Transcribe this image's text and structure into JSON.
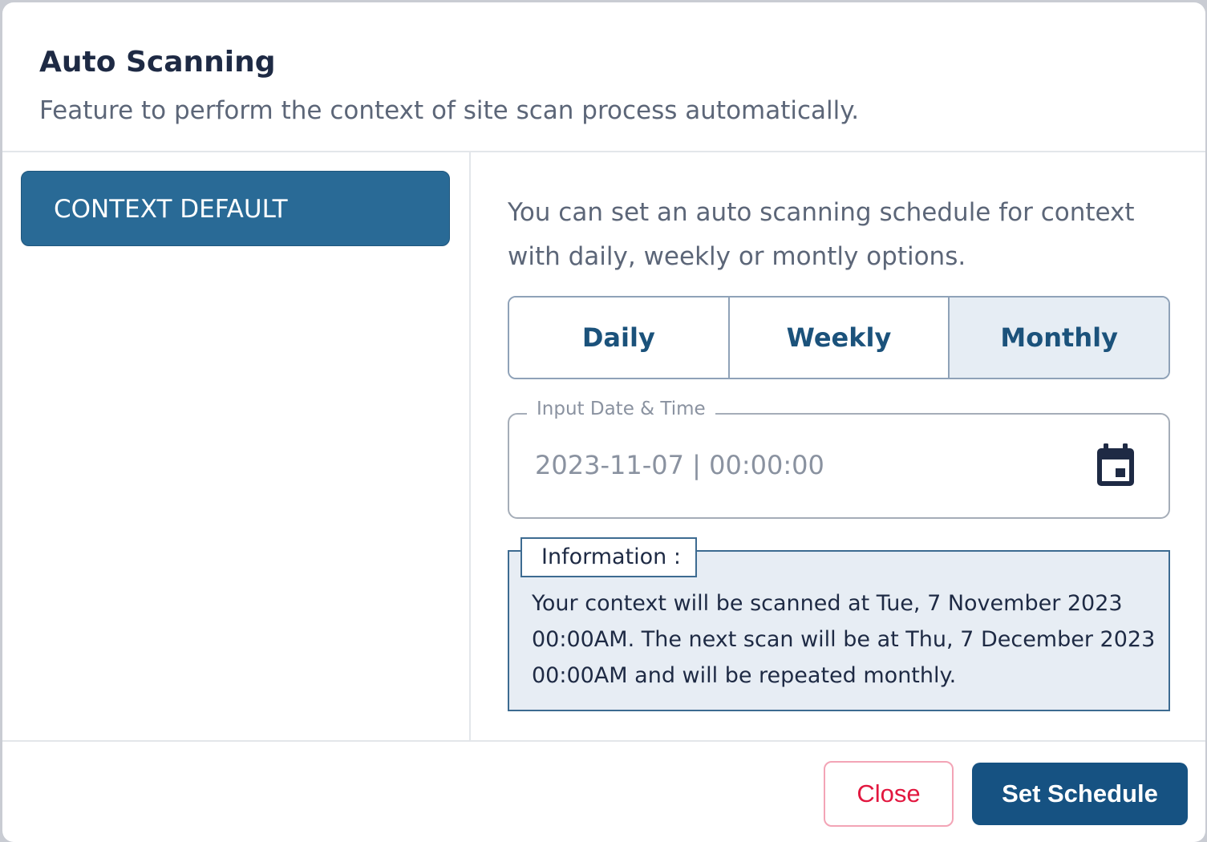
{
  "dialog": {
    "title": "Auto Scanning",
    "subtitle": "Feature to perform the context of site scan process automatically."
  },
  "sidebar": {
    "items": [
      {
        "label": "CONTEXT DEFAULT",
        "selected": true
      }
    ]
  },
  "main": {
    "description": "You can set an auto scanning schedule for context with daily, weekly or montly options.",
    "frequency": {
      "options": [
        "Daily",
        "Weekly",
        "Monthly"
      ],
      "selected": "Monthly"
    },
    "datetime": {
      "label": "Input Date & Time",
      "value": "2023-11-07 | 00:00:00",
      "icon": "calendar-icon"
    },
    "info": {
      "label": "Information :",
      "text": "Your context will be scanned at Tue, 7 November 2023 00:00AM. The next scan will be at Thu, 7 December 2023 00:00AM and will be repeated monthly."
    }
  },
  "footer": {
    "close_label": "Close",
    "set_label": "Set Schedule"
  },
  "colors": {
    "primary": "#165282",
    "sidebar_selected": "#296a96",
    "danger": "#e2173f",
    "info_bg": "#e7edf4"
  }
}
